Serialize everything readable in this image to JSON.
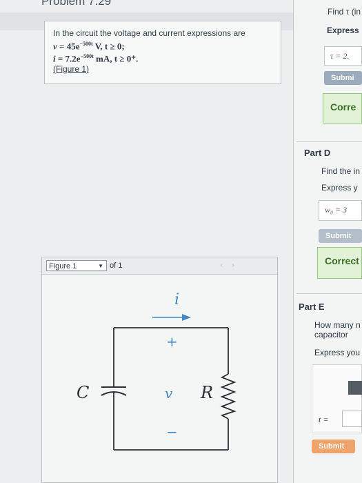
{
  "problem": {
    "title": "Problem 7.29",
    "intro": "In the circuit the voltage and current expressions are",
    "v_lhs": "v",
    "v_eq": " = 45e",
    "v_exp": "−500t",
    "v_tail": " V, t ≥ 0;",
    "i_lhs": "i",
    "i_eq": " = 7.2e",
    "i_exp": "−500t",
    "i_tail": " mA, t ≥ 0⁺.",
    "figure_link": "(Figure 1)"
  },
  "figure": {
    "select_label": "Figure 1",
    "of_label": "of 1",
    "prev_icon": "‹",
    "next_icon": "›",
    "labels": {
      "i": "i",
      "plus": "+",
      "v": "v",
      "minus": "−",
      "c": "C",
      "r": "R"
    }
  },
  "part_c": {
    "find": "Find τ (in",
    "express": "Express",
    "answer": "τ =  2.",
    "submit": "Submi",
    "correct": "Corre"
  },
  "part_d": {
    "title": "Part D",
    "find": "Find the in",
    "express": "Express y",
    "answer": "w₀  =  3",
    "submit": "Submit",
    "correct": "Correct"
  },
  "part_e": {
    "title": "Part E",
    "question1": "How many n",
    "question2": "capacitor",
    "express": "Express you",
    "answer_label": "t =",
    "submit": "Submit"
  },
  "colors": {
    "submit_blue": "#7f93a8",
    "submit_orange": "#f2a36a",
    "correct_green": "#e2f2d6",
    "circuit_line": "#2b2f33",
    "arrow_blue": "#3f88c5"
  }
}
